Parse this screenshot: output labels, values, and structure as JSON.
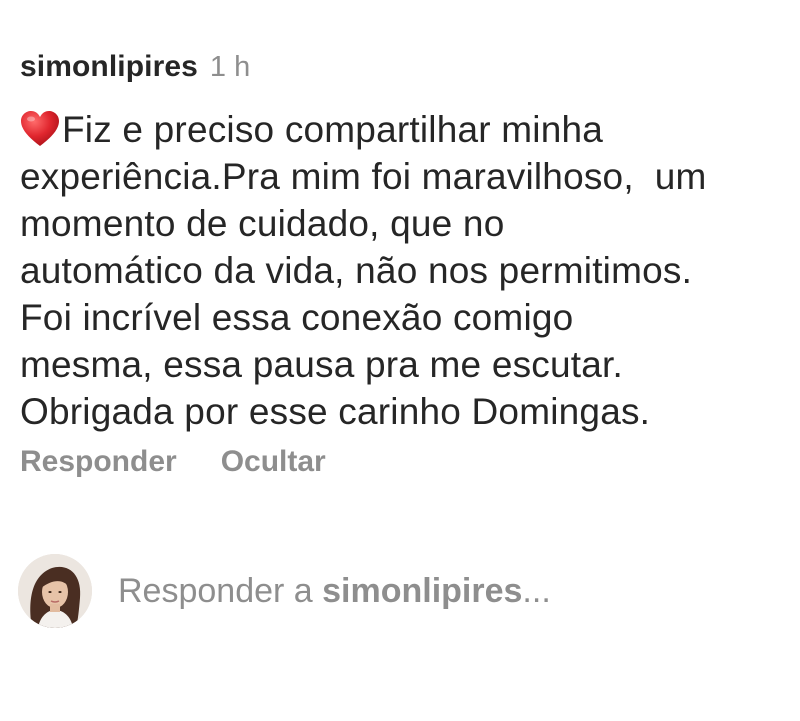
{
  "comment": {
    "username": "simonlipires",
    "timestamp": "1 h",
    "heart_icon": "red-heart-emoji",
    "lines": [
      "Fiz e preciso compartilhar minha",
      "experiência.Pra mim foi maravilhoso,  um",
      "momento de cuidado, que no",
      "automático da vida, não nos permitimos.",
      "Foi incrível essa conexão comigo",
      "mesma, essa pausa pra me escutar.",
      "Obrigada por esse carinho Domingas."
    ],
    "actions": {
      "reply_label": "Responder",
      "hide_label": "Ocultar"
    }
  },
  "reply_bar": {
    "placeholder_prefix": "Responder a ",
    "placeholder_user": "simonlipires",
    "placeholder_suffix": "..."
  },
  "colors": {
    "primary_text": "#262626",
    "secondary_text": "#8e8e8e",
    "heart": "#e0262e",
    "background": "#ffffff"
  }
}
